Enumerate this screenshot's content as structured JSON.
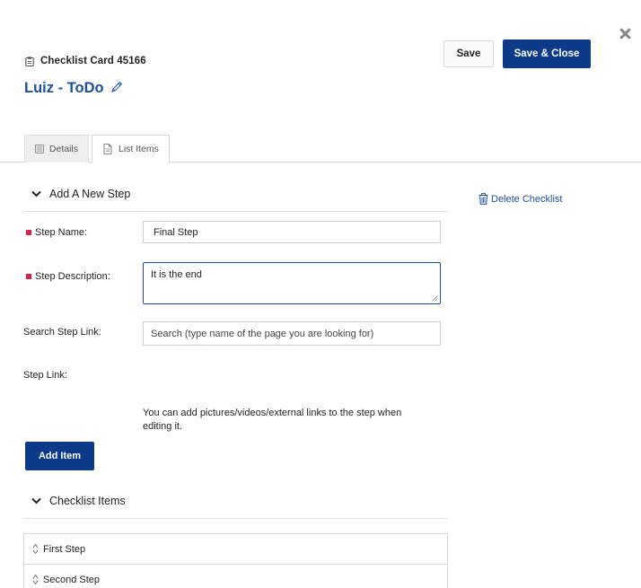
{
  "card": {
    "type_label": "Checklist Card 45166",
    "title": "Luiz - ToDo"
  },
  "toolbar": {
    "save_label": "Save",
    "save_close_label": "Save & Close"
  },
  "tabs": [
    {
      "label": "Details"
    },
    {
      "label": "List Items"
    }
  ],
  "new_step": {
    "section_title": "Add A New Step",
    "step_name_label": "Step Name:",
    "step_name_value": "Final Step",
    "step_description_label": "Step Description:",
    "step_description_value": "It is the end",
    "search_link_label": "Search Step Link:",
    "search_link_placeholder": "Search (type name of the page you are looking for)",
    "step_link_label": "Step Link:",
    "help_text": "You can add pictures/videos/external links to the step when editing it.",
    "add_button_label": "Add Item"
  },
  "sidebar": {
    "delete_label": "Delete Checklist"
  },
  "checklist_items": {
    "section_title": "Checklist Items",
    "items": [
      {
        "label": "First Step"
      },
      {
        "label": "Second Step"
      }
    ]
  },
  "colors": {
    "primary": "#0d3b8a",
    "link": "#1e4f9c",
    "required": "#e0204a"
  }
}
